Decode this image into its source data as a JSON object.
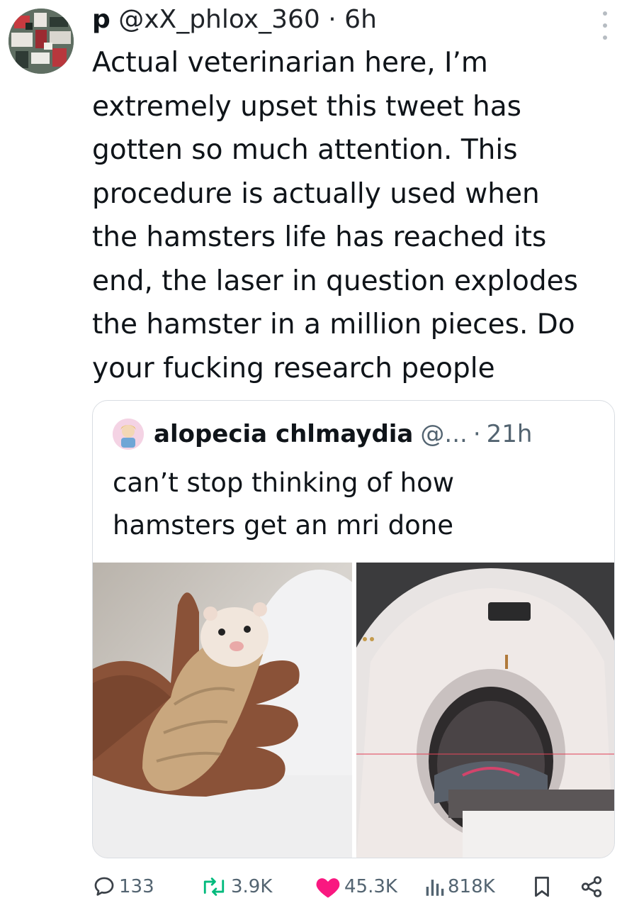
{
  "tweet": {
    "name": "p",
    "handle": "@xX_phlox_360",
    "separator": "·",
    "time": "6h",
    "text_lines": [
      "Actual veterinarian here, I’m",
      "extremely upset this tweet has",
      "gotten so much attention. This",
      "procedure is actually used when",
      "the hamsters life has reached its",
      "end, the laser in question explodes",
      "the hamster in a million pieces. Do",
      "your fucking research people"
    ]
  },
  "quoted": {
    "name": "alopecia chlmaydia",
    "handle": "@...",
    "separator": "·",
    "time": "21h",
    "text_lines": [
      "can’t stop thinking of how",
      "hamsters get an mri done"
    ],
    "images": [
      "hamster-in-hand-photo",
      "mri-machine-photo"
    ]
  },
  "actions": {
    "replies": "133",
    "retweets": "3.9K",
    "likes": "45.3K",
    "views": "818K"
  },
  "colors": {
    "text": "#0f1419",
    "muted": "#536471",
    "like": "#f91880",
    "retweet": "#00ba7c",
    "border": "#d9dde2"
  },
  "icons": [
    "reply-icon",
    "retweet-icon",
    "heart-icon",
    "views-icon",
    "bookmark-icon",
    "share-icon",
    "more-icon"
  ]
}
